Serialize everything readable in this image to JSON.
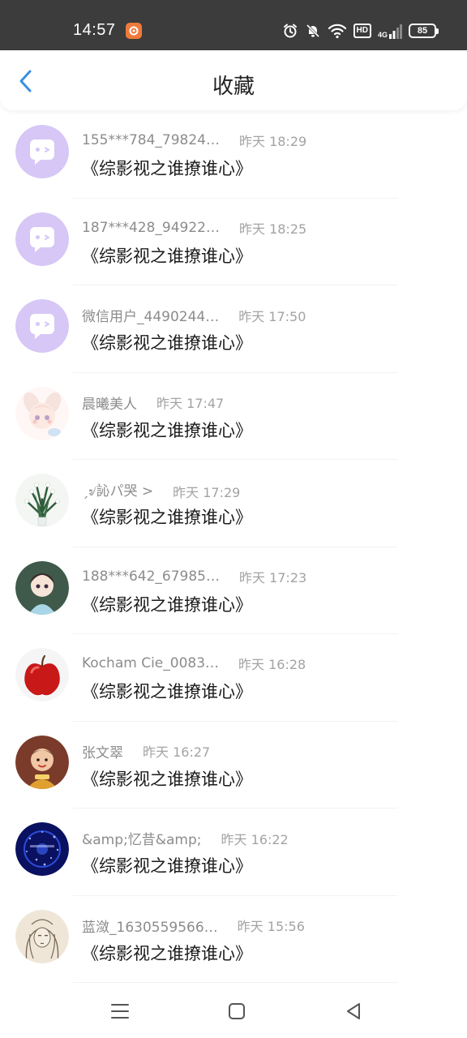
{
  "status": {
    "time": "14:57",
    "hd": "HD",
    "network": "4G",
    "battery": "85"
  },
  "header": {
    "title": "收藏"
  },
  "colors": {
    "accent": "#3b8fe0",
    "chat_avatar_bg": "#d6c7f6",
    "chat_avatar_fg": "#ffffff"
  },
  "items": [
    {
      "name": "155***784_79824…",
      "time": "昨天 18:29",
      "title": "《综影视之谁撩谁心》",
      "avatar": "chat-bubble-icon"
    },
    {
      "name": "187***428_94922…",
      "time": "昨天 18:25",
      "title": "《综影视之谁撩谁心》",
      "avatar": "chat-bubble-icon"
    },
    {
      "name": "微信用户_4490244…",
      "time": "昨天 17:50",
      "title": "《综影视之谁撩谁心》",
      "avatar": "chat-bubble-icon"
    },
    {
      "name": "晨曦美人",
      "time": "昨天 17:47",
      "title": "《综影视之谁撩谁心》",
      "avatar": "anime-girl-photo"
    },
    {
      "name": "ˏ৶訫パ哭 >",
      "time": "昨天 17:29",
      "title": "《综影视之谁撩谁心》",
      "avatar": "lily-of-valley-photo"
    },
    {
      "name": "188***642_67985…",
      "time": "昨天 17:23",
      "title": "《综影视之谁撩谁心》",
      "avatar": "anime-boy-photo"
    },
    {
      "name": "Kocham Cie_0083…",
      "time": "昨天 16:28",
      "title": "《综影视之谁撩谁心》",
      "avatar": "red-apple-photo"
    },
    {
      "name": "张文翠",
      "time": "昨天 16:27",
      "title": "《综影视之谁撩谁心》",
      "avatar": "baby-photo"
    },
    {
      "name": "&amp;忆昔&amp;",
      "time": "昨天 16:22",
      "title": "《综影视之谁撩谁心》",
      "avatar": "starry-blue-photo"
    },
    {
      "name": "蓝潋_1630559566…",
      "time": "昨天 15:56",
      "title": "《综影视之谁撩谁心》",
      "avatar": "sketch-girl-photo"
    }
  ],
  "navbar": {
    "buttons": [
      "menu-icon",
      "home-icon",
      "back-triangle-icon"
    ]
  }
}
